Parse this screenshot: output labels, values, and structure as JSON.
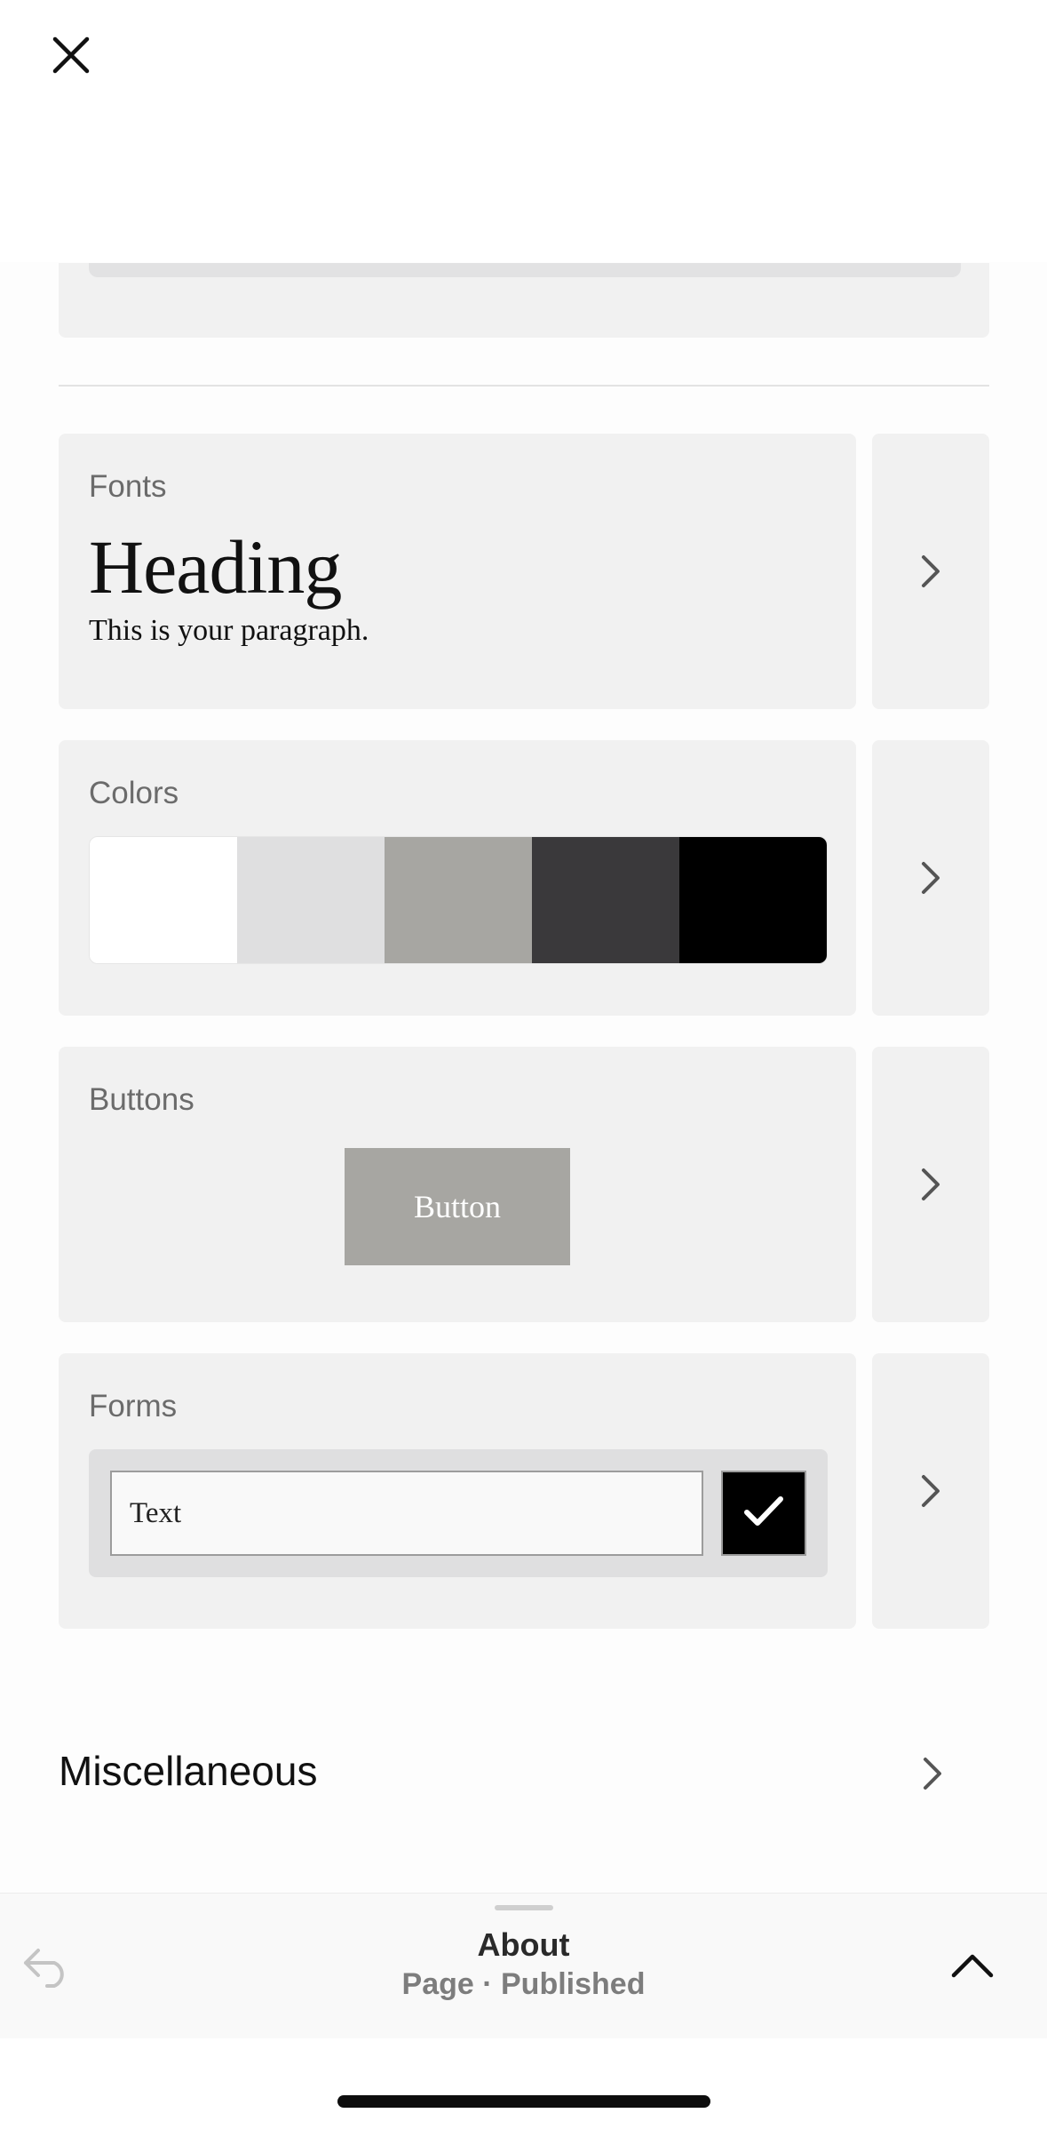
{
  "close": {
    "icon": "close-icon"
  },
  "sections": {
    "fonts": {
      "label": "Fonts",
      "heading_sample": "Heading",
      "paragraph_sample": "This is your paragraph."
    },
    "colors": {
      "label": "Colors",
      "palette": [
        "#ffffff",
        "#dfdfe0",
        "#a7a6a2",
        "#3a393b",
        "#000000"
      ]
    },
    "buttons": {
      "label": "Buttons",
      "button_sample": "Button",
      "button_color": "#a7a6a2"
    },
    "forms": {
      "label": "Forms",
      "input_value": "Text",
      "checkbox_checked": true
    }
  },
  "miscellaneous": {
    "label": "Miscellaneous"
  },
  "bottom_bar": {
    "title": "About",
    "status": "Page · Published",
    "undo_icon": "undo-icon",
    "collapse_icon": "chevron-up-icon"
  }
}
